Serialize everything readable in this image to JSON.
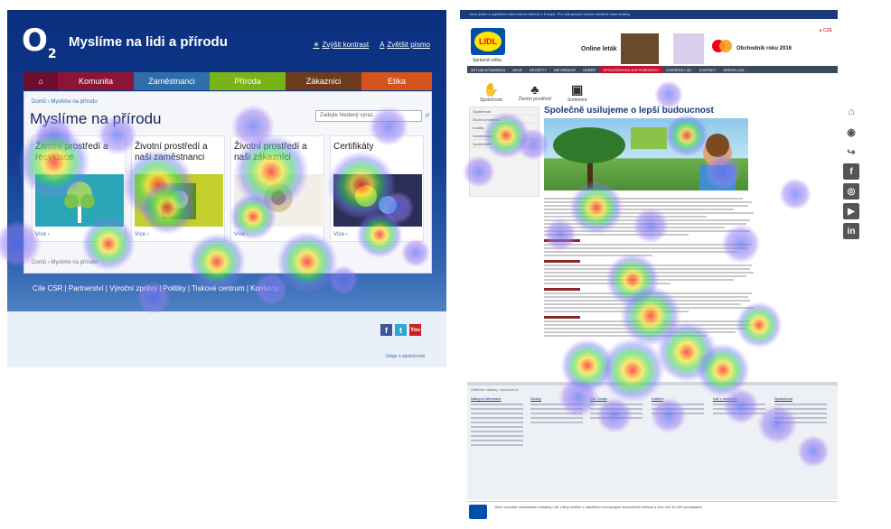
{
  "o2": {
    "logo": "O",
    "logo_sub": "2",
    "title": "Myslíme na lidi a přírodu",
    "tools": [
      "Zvýšit kontrast",
      "Zvětšit písmo"
    ],
    "nav": [
      {
        "label": "Komunita",
        "color": "#8a1538"
      },
      {
        "label": "Zaměstnanci",
        "color": "#2f6ea8"
      },
      {
        "label": "Příroda",
        "color": "#7ab317"
      },
      {
        "label": "Zákazníci",
        "color": "#6d3b1e"
      },
      {
        "label": "Etika",
        "color": "#d3541c"
      }
    ],
    "breadcrumb": "Domů  ›  Myslíme na přírodu",
    "heading": "Myslíme na přírodu",
    "search_placeholder": "Zadejte hledaný výraz",
    "cards": [
      {
        "title": "Životní prostředí a recyklace",
        "more": "Více  ›"
      },
      {
        "title": "Životní prostředí a naši zaměstnanci",
        "more": "Více  ›"
      },
      {
        "title": "Životní prostředí a naši zákazníci",
        "more": "Více  ›"
      },
      {
        "title": "Certifikáty",
        "more": "Více  ›"
      }
    ],
    "breadcrumb_bottom": "Domů  ›  Myslíme na přírodu",
    "footer_links": "Cíle CSR  |  Partnerství  |  Výroční zprávy  |  Politiky  |  Tiskové centrum  |  Kontakty",
    "social": [
      "f",
      "t",
      "You"
    ],
    "small_link": "Údaje o společnosti"
  },
  "lidl": {
    "topbar": "Jsme jeden z nejvetších obchodních řetězců v Evropě. Pro nakupování chcete navštívit naše stránky",
    "logo": "LIDL",
    "slogan": "Správná volba",
    "ad1": "Online leták",
    "ad2": "Obchodník roku 2016",
    "login": "▸ CZE",
    "nav": [
      "AKTUÁLNÍ NABÍDKA",
      "AKCE",
      "RECEPTY",
      "INFORMACE",
      "ODBĚR",
      "SPOLEČENSKÁ ODPOVĚDNOST",
      "KARIÉRNÍ LIDL",
      "KONTAKT",
      "SERVIS LIDL"
    ],
    "icons": [
      {
        "label": "Společnost",
        "glyph": "✋"
      },
      {
        "label": "Životní prostředí",
        "glyph": "♣"
      },
      {
        "label": "Sortiment",
        "glyph": "▣"
      }
    ],
    "sidenav": [
      "Společnost",
      "Životní prostředí",
      "Kvalita",
      "Zaměstnanci",
      "Spotřebitelé"
    ],
    "heading": "Společně usilujeme o lepší budoucnost",
    "footer_header": "Užitečné odkazy  •  www.lidl.cz",
    "footer_cols": [
      "Nákupní informace",
      "Služby",
      "Lidl Česká",
      "Kariéra",
      "Lidl v zahraničí",
      "Společnost"
    ],
    "bottom_text": "Jsme součástí mezinárodní skupiny Lidl. Lidl je jedním z největších evropských obchodních řetězců s více než 10 000 prodejnami."
  },
  "side_icons": [
    "hanger-icon",
    "chat-icon",
    "redo-icon",
    "facebook-icon",
    "instagram-icon",
    "youtube-icon",
    "linkedin-icon"
  ],
  "side_glyphs": [
    "⌂",
    "◉",
    "↪",
    "f",
    "◎",
    "▶",
    "in"
  ]
}
